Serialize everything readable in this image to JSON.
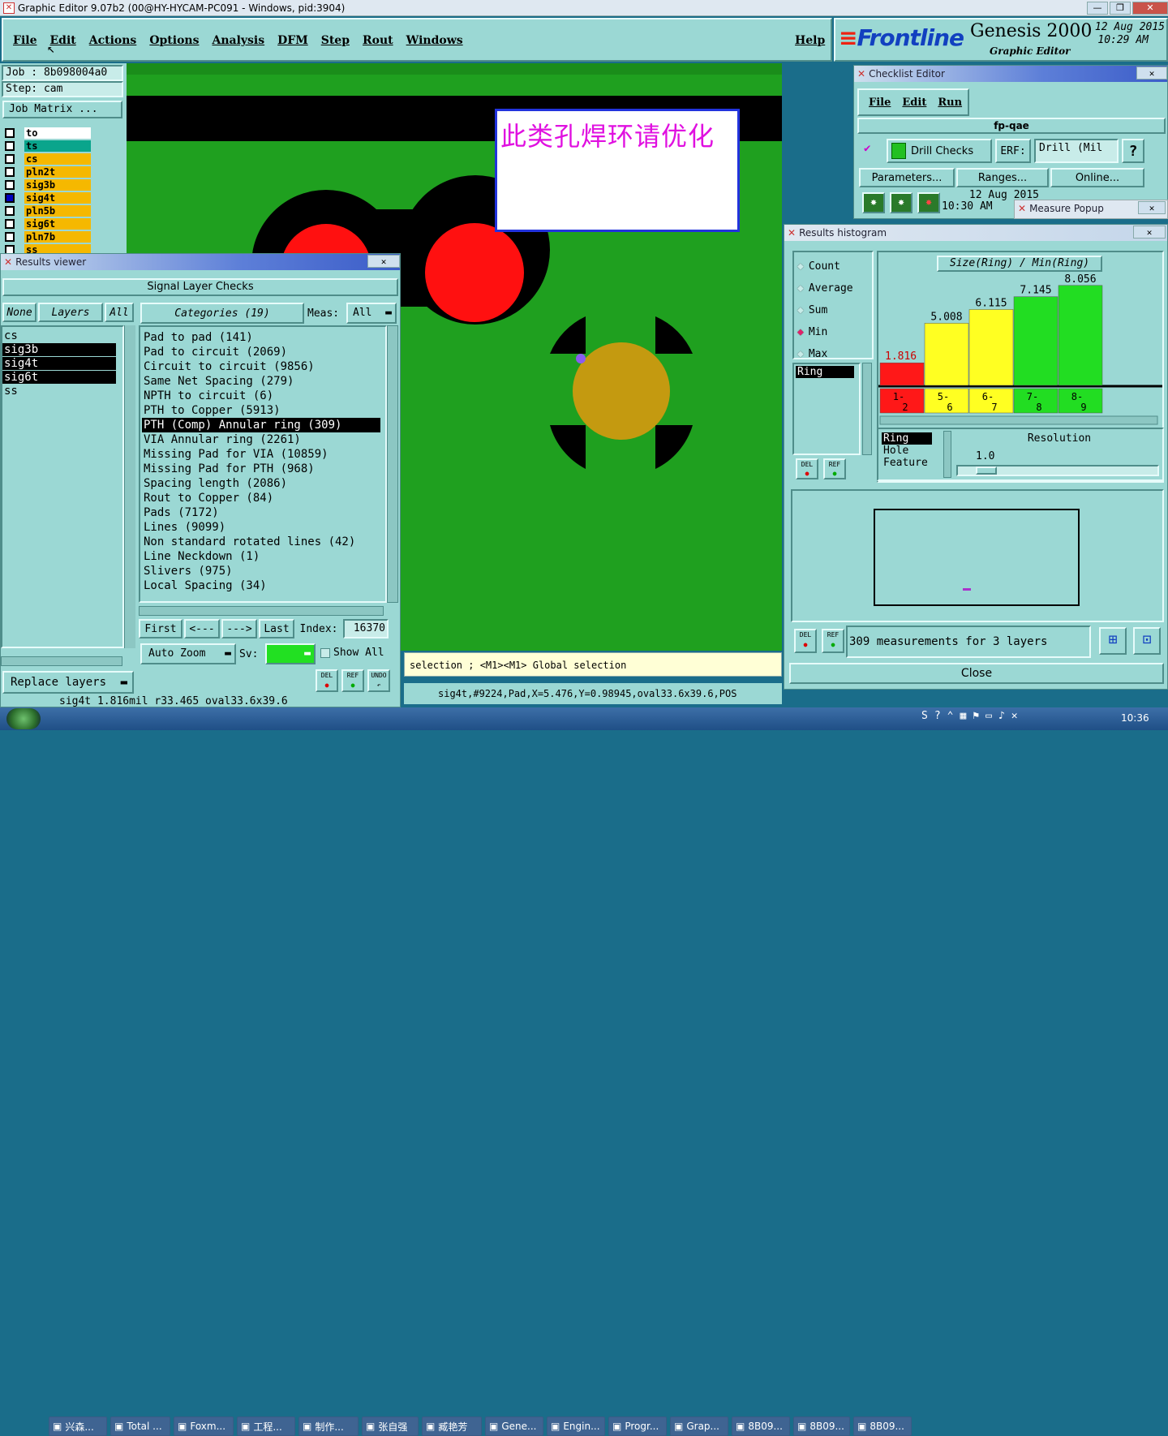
{
  "window": {
    "title": "Graphic Editor 9.07b2 (00@HY-HYCAM-PC091 - Windows, pid:3904)",
    "controls": [
      "—",
      "❐",
      "✕"
    ]
  },
  "menubar": {
    "items": [
      "File",
      "Edit",
      "Actions",
      "Options",
      "Analysis",
      "DFM",
      "Step",
      "Rout",
      "Windows"
    ],
    "help": "Help"
  },
  "brand": {
    "logo": "Frontline",
    "product": "Genesis 2000",
    "subtitle": "Graphic Editor",
    "date": "12 Aug 2015",
    "time": "10:29 AM"
  },
  "job": {
    "job_label": "Job : 8b098004a0",
    "step_label": "Step: cam",
    "matrix_button": "Job Matrix ..."
  },
  "layers": [
    {
      "name": "to",
      "color": "#ffffff"
    },
    {
      "name": "ts",
      "color": "#0aa58c"
    },
    {
      "name": "cs",
      "color": "#f5b800"
    },
    {
      "name": "pln2t",
      "color": "#f5b800"
    },
    {
      "name": "sig3b",
      "color": "#f5b800"
    },
    {
      "name": "sig4t",
      "color": "#f5b800"
    },
    {
      "name": "pln5b",
      "color": "#f5b800"
    },
    {
      "name": "sig6t",
      "color": "#f5b800"
    },
    {
      "name": "pln7b",
      "color": "#f5b800"
    },
    {
      "name": "ss",
      "color": "#f5b800"
    }
  ],
  "canvas": {
    "annotation": "此类孔焊环请优化",
    "selection_text": "selection ; <M1><M1> Global selection",
    "status_text": "sig4t,#9224,Pad,X=5.476,Y=0.98945,oval33.6x39.6,POS"
  },
  "results_viewer": {
    "title": "Results viewer",
    "header": "Signal Layer Checks",
    "btn_none": "None",
    "btn_layers": "Layers",
    "btn_all": "All",
    "layer_items": [
      "cs",
      "sig3b",
      "sig4t",
      "sig6t",
      "ss"
    ],
    "categories_label": "Categories (19)",
    "meas_label": "Meas:",
    "meas_value": "All",
    "categories": [
      "Pad to pad (141)",
      "Pad to circuit (2069)",
      "Circuit to circuit (9856)",
      "Same Net Spacing (279)",
      "NPTH to circuit (6)",
      "PTH to Copper (5913)",
      "PTH (Comp) Annular ring (309)",
      "VIA Annular ring (2261)",
      "Missing Pad for VIA (10859)",
      "Missing Pad for PTH (968)",
      "Spacing length (2086)",
      "Rout to Copper (84)",
      "Pads (7172)",
      "Lines (9099)",
      "Non standard rotated lines (42)",
      "Line Neckdown (1)",
      "Slivers (975)",
      "Local Spacing (34)"
    ],
    "nav": {
      "first": "First",
      "prev": "<---",
      "next": "--->",
      "last": "Last",
      "index_label": "Index:",
      "index_value": "16370"
    },
    "auto_zoom": "Auto Zoom",
    "sv_label": "Sv:",
    "show_all": "Show All",
    "replace_layers": "Replace layers",
    "tool_icons": [
      "DEL",
      "REF",
      "UNDO"
    ],
    "status": "sig4t  1.816mil  r33.465  oval33.6x39.6"
  },
  "checklist": {
    "title": "Checklist Editor",
    "menu": [
      "File",
      "Edit",
      "Run"
    ],
    "name": "fp-qae",
    "check_name": "Drill Checks",
    "erf_label": "ERF:",
    "erf_value": "Drill (Mil",
    "help": "?",
    "params": "Parameters...",
    "ranges": "Ranges...",
    "online": "Online...",
    "date": "12 Aug 2015",
    "time": "10:30 AM"
  },
  "measure_popup": {
    "title": "Measure Popup"
  },
  "histogram": {
    "title": "Results histogram",
    "stats": [
      {
        "label": "Count",
        "selected": false
      },
      {
        "label": "Average",
        "selected": false
      },
      {
        "label": "Sum",
        "selected": false
      },
      {
        "label": "Min",
        "selected": true
      },
      {
        "label": "Max",
        "selected": false
      }
    ],
    "filter_item": "Ring",
    "chart_title": "Size(Ring) / Min(Ring)",
    "res_items": [
      "Ring",
      "Hole",
      "Feature"
    ],
    "resolution_label": "Resolution",
    "resolution_value": "1.0",
    "summary": "309 measurements for 3 layers",
    "close": "Close",
    "tool_icons": [
      "DEL",
      "REF"
    ]
  },
  "chart_data": {
    "type": "bar",
    "title": "Size(Ring) / Min(Ring)",
    "categories": [
      "1-2",
      "5-6",
      "6-7",
      "7-8",
      "8-9"
    ],
    "values": [
      1.816,
      5.008,
      6.115,
      7.145,
      8.056
    ],
    "bar_colors": [
      "#ff1818",
      "#ffff22",
      "#ffff22",
      "#22dd22",
      "#22dd22"
    ],
    "ylim": [
      0,
      8.5
    ]
  },
  "taskbar": {
    "items": [
      "兴森...",
      "Total ...",
      "Foxm...",
      "工程...",
      "制作...",
      "张自强",
      "臧艳芳",
      "Gene...",
      "Engin...",
      "Progr...",
      "Grap...",
      "8B09...",
      "8B09...",
      "8B09..."
    ],
    "clock": "10:36"
  }
}
